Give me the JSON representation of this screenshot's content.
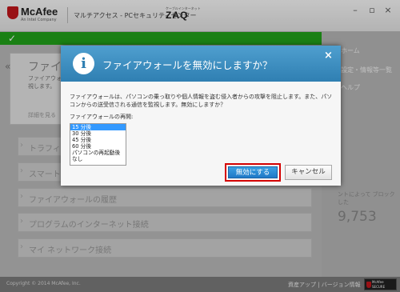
{
  "app": {
    "brand": "McAfee",
    "brand_sub": "An Intel Company",
    "title": "マルチアクセス - PCセキュリティセンター",
    "isp_logo": "ZAQ",
    "isp_tag": "ケーブルインターネット"
  },
  "window_controls": {
    "minimize": "–",
    "maximize": "▫",
    "close": "×"
  },
  "status": {
    "icon": "✓",
    "color": "#22a51a"
  },
  "firewall_card": {
    "title": "ファイア",
    "text": "ファイアウォー 監視します。",
    "link": "詳細を見る"
  },
  "menu_rows": {
    "traffic": "トラフィ",
    "smart": "スマート",
    "history": "ファイアウォールの履歴",
    "program": "プログラムのインターネット接続",
    "network": "マイ ネットワーク接続"
  },
  "side_panel": {
    "home": "ホーム",
    "settings": "設定・情報等一覧",
    "help": "ヘルプ",
    "label": "ントによって ブロックした",
    "number": "9,753"
  },
  "footer": {
    "copyright": "Copyright © 2014 McAfee, Inc.",
    "links": "資産アップ | バージョン情報",
    "badge_line1": "McAfee",
    "badge_line2": "SECURE"
  },
  "dialog": {
    "title": "ファイアウォールを無効にしますか？",
    "close": "×",
    "message": "ファイアウォールは、パソコンの乗っ取りや個人情報を盗む侵入者からの攻撃を阻止します。また、パソコンからの送受信される通信を監視します。無効にしますか？",
    "reenable_label": "ファイアウォールの再開:",
    "time_options": [
      "15 分後",
      "30 分後",
      "45 分後",
      "60 分後",
      "パソコンの再起動後",
      "なし"
    ],
    "selected_option": "15 分後",
    "disable_button": "無効にする",
    "cancel_button": "キャンセル"
  },
  "colors": {
    "dialog_header": "#3a8fc2",
    "primary_button": "#1f78c6",
    "highlight_border": "#d40000",
    "selection": "#3399ff"
  }
}
